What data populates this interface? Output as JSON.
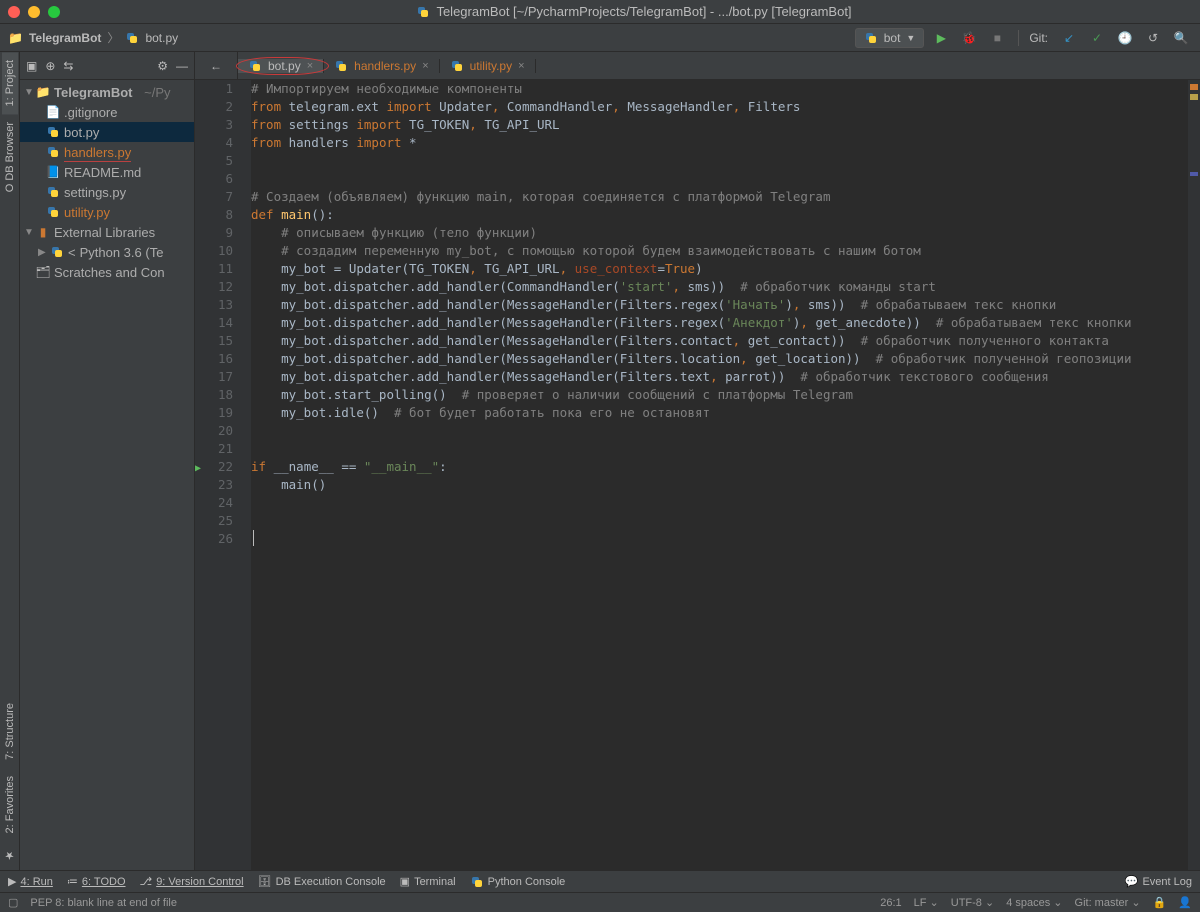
{
  "titlebar": {
    "title": "TelegramBot [~/PycharmProjects/TelegramBot] - .../bot.py [TelegramBot]"
  },
  "breadcrumb": {
    "project": "TelegramBot",
    "file": "bot.py"
  },
  "run_config": {
    "label": "bot"
  },
  "toolbar": {
    "git_label": "Git:"
  },
  "side_tabs": {
    "left": [
      "1: Project",
      "O DB Browser"
    ],
    "bottom_left": [
      "7: Structure",
      "2: Favorites"
    ]
  },
  "tree": {
    "project_name": "TelegramBot",
    "project_path": "~/Py",
    "files": [
      {
        "name": ".gitignore",
        "type": "file"
      },
      {
        "name": "bot.py",
        "type": "py",
        "selected": true
      },
      {
        "name": "handlers.py",
        "type": "py",
        "highlight": true,
        "underline": true
      },
      {
        "name": "README.md",
        "type": "md"
      },
      {
        "name": "settings.py",
        "type": "py"
      },
      {
        "name": "utility.py",
        "type": "py",
        "highlight": true
      }
    ],
    "external": "External Libraries",
    "python": "Python 3.6 (Te",
    "scratches": "Scratches and Con"
  },
  "tabs": [
    {
      "label": "bot.py",
      "active": true,
      "circled": true
    },
    {
      "label": "handlers.py",
      "highlight": true
    },
    {
      "label": "utility.py",
      "highlight": true
    }
  ],
  "code": {
    "lines_count": 26,
    "play_line": 22
  },
  "bottom_tools": {
    "run": "4: Run",
    "todo": "6: TODO",
    "vcs": "9: Version Control",
    "db": "DB Execution Console",
    "terminal": "Terminal",
    "pyconsole": "Python Console",
    "eventlog": "Event Log"
  },
  "status": {
    "msg": "PEP 8: blank line at end of file",
    "pos": "26:1",
    "le": "LF",
    "enc": "UTF-8",
    "indent": "4 spaces",
    "branch": "Git: master"
  }
}
